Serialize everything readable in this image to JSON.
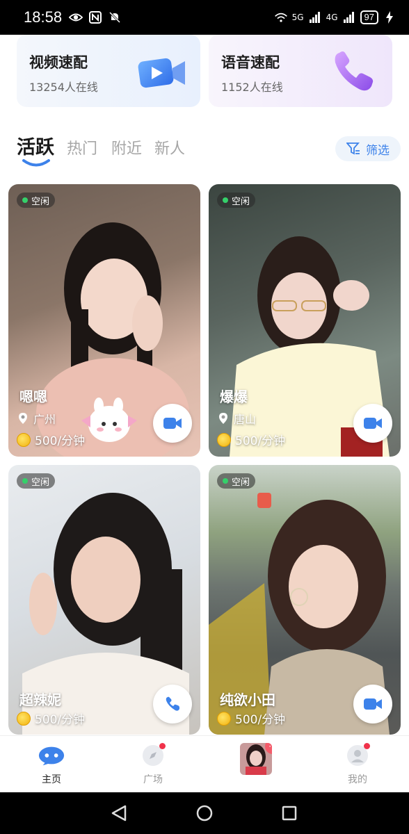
{
  "status_bar": {
    "time": "18:58",
    "battery": "97",
    "signal_labels": [
      "5G",
      "4G"
    ]
  },
  "quick_match": [
    {
      "title": "视频速配",
      "subtitle": "13254人在线",
      "icon": "video-camera-icon"
    },
    {
      "title": "语音速配",
      "subtitle": "1152人在线",
      "icon": "phone-icon"
    }
  ],
  "tabs": [
    {
      "label": "活跃",
      "active": true
    },
    {
      "label": "热门",
      "active": false
    },
    {
      "label": "附近",
      "active": false
    },
    {
      "label": "新人",
      "active": false
    }
  ],
  "filter": {
    "label": "筛选",
    "icon": "filter-icon"
  },
  "cards": [
    {
      "name": "嗯嗯",
      "status": "空闲",
      "city": "广州",
      "price": "500/分钟",
      "call_type": "video",
      "sticker": true
    },
    {
      "name": "爆爆",
      "status": "空闲",
      "city": "唐山",
      "price": "500/分钟",
      "call_type": "video",
      "sticker": false
    },
    {
      "name": "超辣妮",
      "status": "空闲",
      "city": "",
      "price": "500/分钟",
      "call_type": "voice",
      "sticker": false
    },
    {
      "name": "纯欲小田",
      "status": "空闲",
      "city": "",
      "price": "500/分钟",
      "call_type": "video",
      "sticker": false
    }
  ],
  "bottom_nav": [
    {
      "label": "主页",
      "icon": "home-icon",
      "active": true,
      "dot": false
    },
    {
      "label": "广场",
      "icon": "compass-icon",
      "active": false,
      "dot": true
    },
    {
      "label": "",
      "icon": "avatar-message-icon",
      "active": false,
      "dot": false,
      "badge": "···"
    },
    {
      "label": "我的",
      "icon": "profile-icon",
      "active": false,
      "dot": true
    }
  ],
  "colors": {
    "accent_blue": "#3d82ea",
    "online_green": "#35d06a",
    "badge_red": "#f0324a",
    "coin_gold": "#f2b10c"
  }
}
